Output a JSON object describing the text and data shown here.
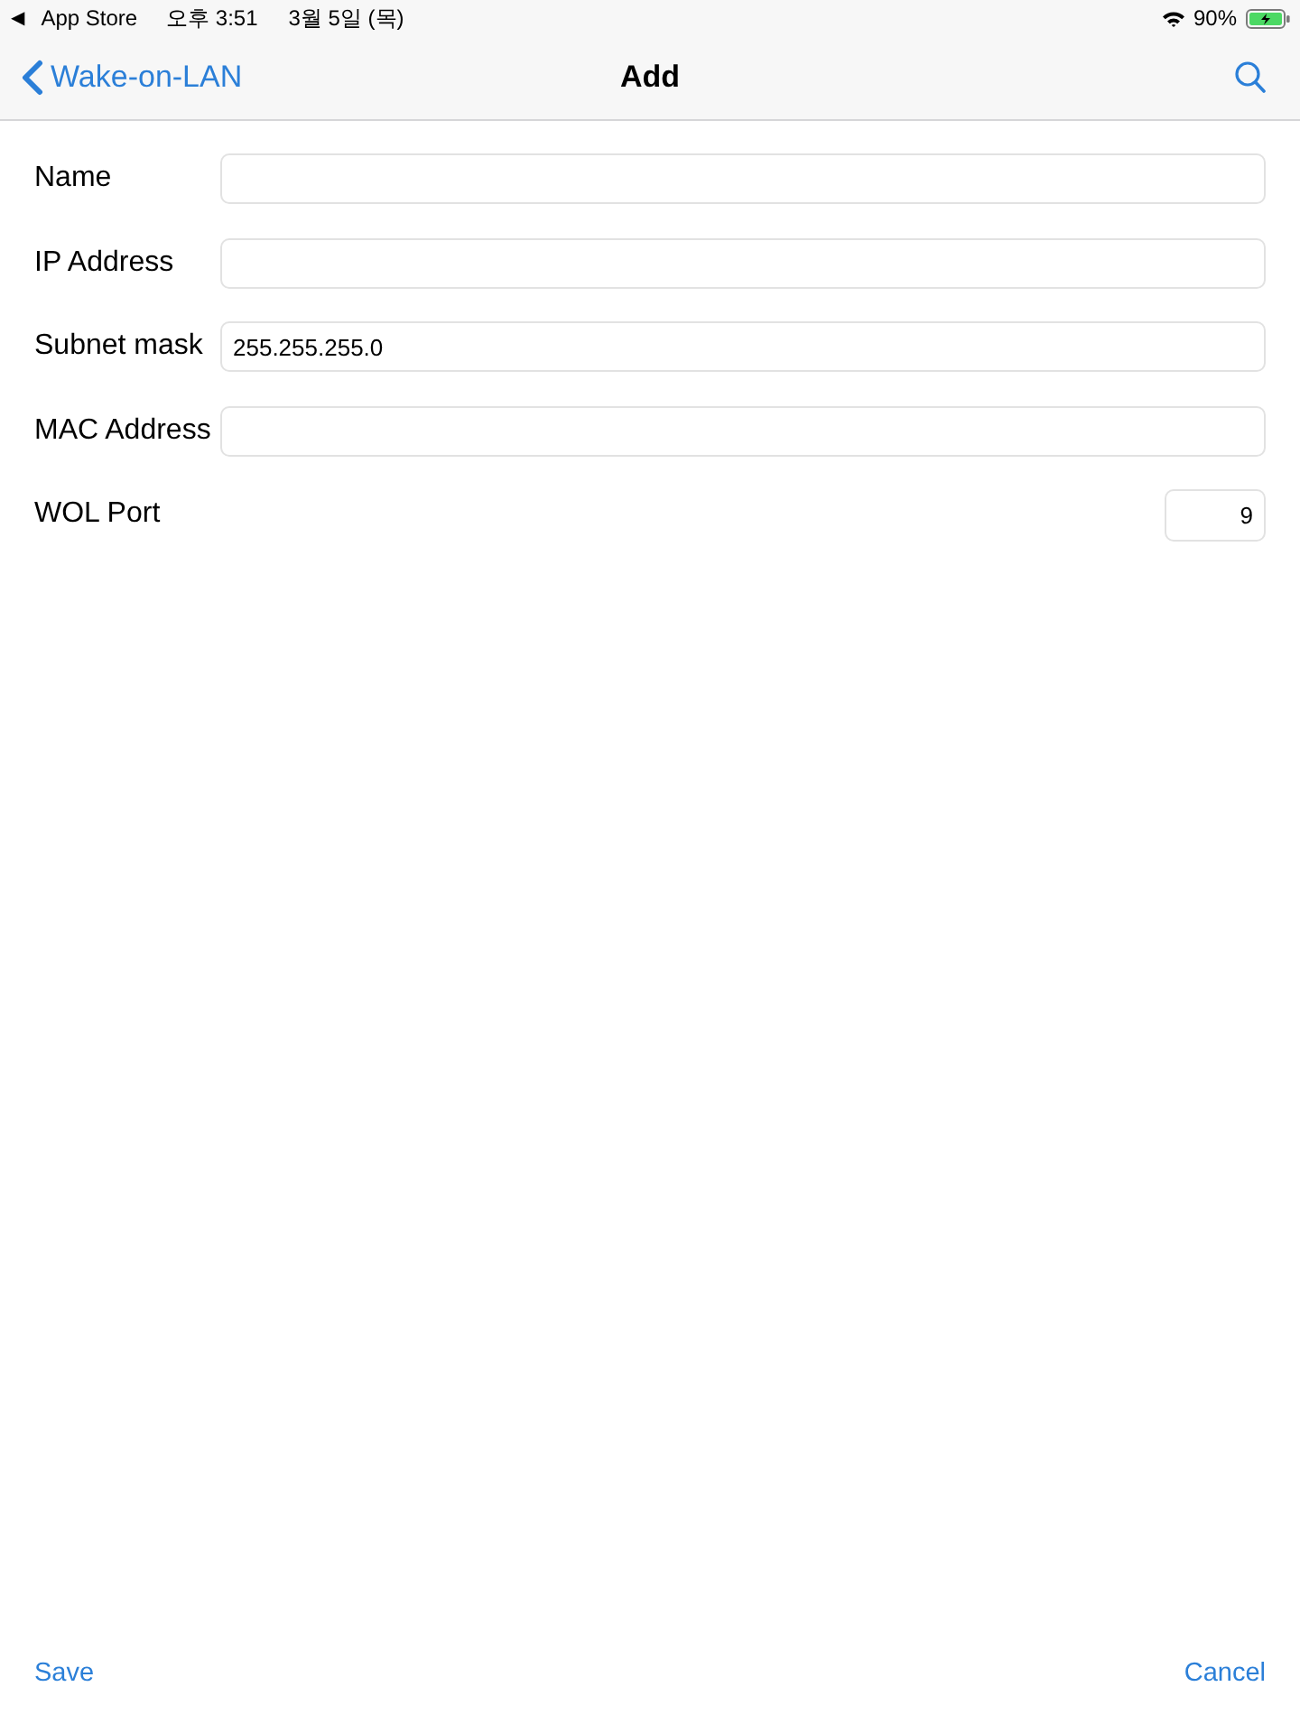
{
  "status_bar": {
    "back_arrow": "◀",
    "back_app": "App Store",
    "time": "오후 3:51",
    "date": "3월 5일 (목)",
    "battery": "90%"
  },
  "nav": {
    "back": "Wake-on-LAN",
    "title": "Add"
  },
  "fields": [
    {
      "label": "Name",
      "kind": "text"
    },
    {
      "label": "IP Address",
      "kind": "text"
    },
    {
      "label": "Subnet mask",
      "kind": "text",
      "value": "255.255.255.0"
    },
    {
      "label": "MAC Address",
      "kind": "text"
    },
    {
      "label": "WOL Port",
      "kind": "number",
      "value": "9"
    }
  ],
  "toolbar": {
    "left": "Save",
    "right": "Cancel"
  }
}
